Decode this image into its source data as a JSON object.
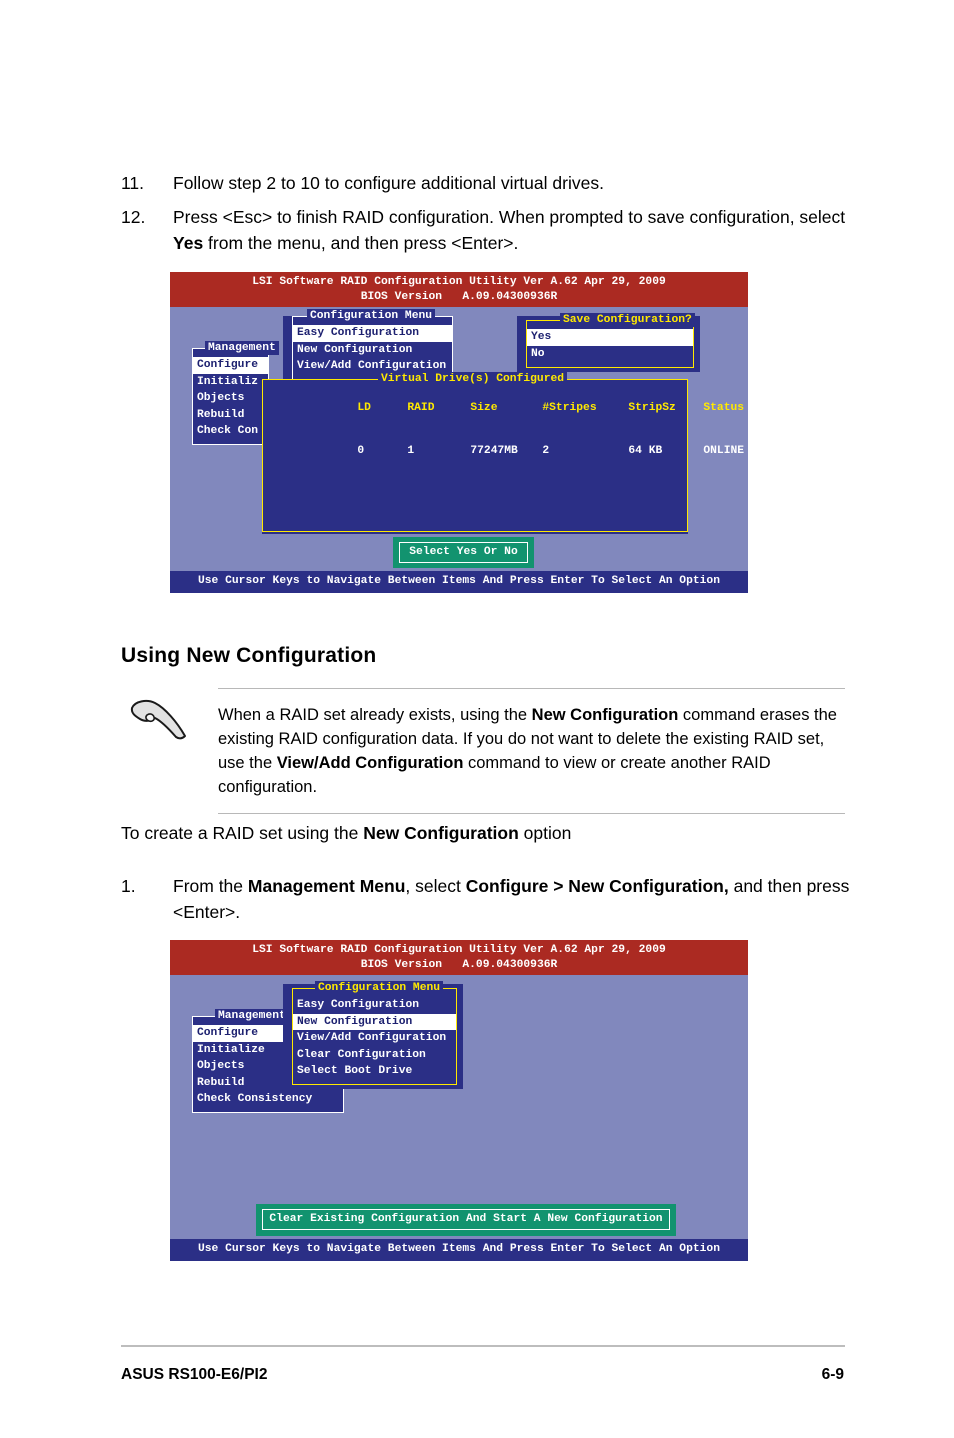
{
  "steps_top": [
    {
      "num": "11.",
      "text": "Follow step 2 to 10 to configure additional virtual drives."
    },
    {
      "num": "12.",
      "text_pre": "Press <Esc> to finish RAID configuration. When prompted to save configuration, select ",
      "bold": "Yes",
      "text_post": " from the menu, and then press <Enter>."
    }
  ],
  "section_heading": "Using New Configuration",
  "note": {
    "icon": "pointing-hand-icon",
    "line_pre_1": "When a RAID set already exists, using the ",
    "bold_1": "New Configuration",
    "line_mid_1": " command erases the existing RAID configuration data. If you do not want to delete the existing RAID set, use the ",
    "bold_2": "View/Add Configuration",
    "line_post": " command to view or create another RAID configuration."
  },
  "lead": {
    "pre": "To create a RAID set using the ",
    "bold": "New Configuration",
    "post": " option"
  },
  "step1": {
    "num": "1.",
    "pre": "From the ",
    "bold1": "Management Menu",
    "mid1": ", select ",
    "bold2": "Configure > New Configuration,",
    "post": " and then press <Enter>."
  },
  "bios_common": {
    "title_line1": "LSI Software RAID Configuration Utility Ver A.62 Apr 29, 2009",
    "title_line2": "BIOS Version   A.09.04300936R",
    "footer": "Use Cursor Keys to Navigate Between Items And Press Enter To Select An Option",
    "colors": {
      "desktop": "#8188bd",
      "title_bar": "#ab2a22",
      "panel": "#2b2f86",
      "panel_border": "#ffffff",
      "panel_border_yellow": "#ffe900",
      "highlight_bg": "#ffffff",
      "highlight_fg": "#1d2170",
      "status_bar": "#2b2f86",
      "green_box": "#12936f",
      "table_header_fg": "#ffe900"
    }
  },
  "screen1": {
    "management": {
      "legend": "Management",
      "items": [
        {
          "label": "Configure",
          "selected": true
        },
        {
          "label": "Initializ",
          "selected": false
        },
        {
          "label": "Objects",
          "selected": false
        },
        {
          "label": "Rebuild",
          "selected": false
        },
        {
          "label": "Check Con",
          "selected": false
        }
      ]
    },
    "configuration_menu": {
      "legend": "Configuration Menu",
      "items": [
        {
          "label": "Easy Configuration",
          "selected": true
        },
        {
          "label": "New Configuration",
          "selected": false
        },
        {
          "label": "View/Add Configuration",
          "selected": false
        }
      ]
    },
    "save_dialog": {
      "legend": "Save Configuration?",
      "items": [
        {
          "label": "Yes",
          "selected": true
        },
        {
          "label": "No",
          "selected": false
        }
      ]
    },
    "virtual_drives": {
      "legend": "Virtual Drive(s) Configured",
      "columns": [
        "LD",
        "RAID",
        "Size",
        "#Stripes",
        "StripSz",
        "Status"
      ],
      "rows": [
        [
          "0",
          "1",
          "77247MB",
          "2",
          "64 KB",
          "ONLINE"
        ]
      ]
    },
    "prompt": "Select Yes Or No"
  },
  "screen2": {
    "management": {
      "legend": "Management",
      "items": [
        {
          "label": "Configure",
          "selected": true
        },
        {
          "label": "Initialize",
          "selected": false
        },
        {
          "label": "Objects",
          "selected": false
        },
        {
          "label": "Rebuild",
          "selected": false
        },
        {
          "label": "Check Consistency",
          "selected": false
        }
      ]
    },
    "configuration_menu": {
      "legend": "Configuration Menu",
      "items": [
        {
          "label": "Easy Configuration",
          "selected": false
        },
        {
          "label": "New Configuration",
          "selected": true
        },
        {
          "label": "View/Add Configuration",
          "selected": false
        },
        {
          "label": "Clear Configuration",
          "selected": false
        },
        {
          "label": "Select Boot Drive",
          "selected": false
        }
      ]
    },
    "prompt": "Clear Existing Configuration And Start A New Configuration"
  },
  "page_footer": {
    "left": "ASUS RS100-E6/PI2",
    "right": "6-9"
  }
}
